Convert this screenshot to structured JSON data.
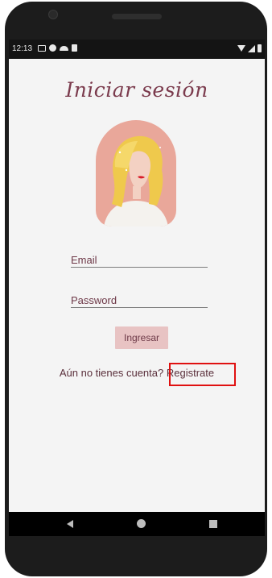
{
  "statusbar": {
    "time": "12:13",
    "icons": [
      "image-icon",
      "circle-icon",
      "cloud-icon",
      "sdcard-icon"
    ],
    "right_icons": [
      "wifi-icon",
      "signal-icon",
      "battery-icon"
    ]
  },
  "login": {
    "title": "Iniciar sesión",
    "email_placeholder": "Email",
    "password_placeholder": "Password",
    "submit_label": "Ingresar",
    "register_prompt": "Aún no tienes cuenta?",
    "register_link": "Registrate"
  },
  "navbar": {
    "buttons": [
      "back-icon",
      "home-icon",
      "recents-icon"
    ]
  },
  "colors": {
    "accent": "#7b3b4d",
    "button_bg": "#e8c3c3",
    "highlight": "#e01010"
  }
}
